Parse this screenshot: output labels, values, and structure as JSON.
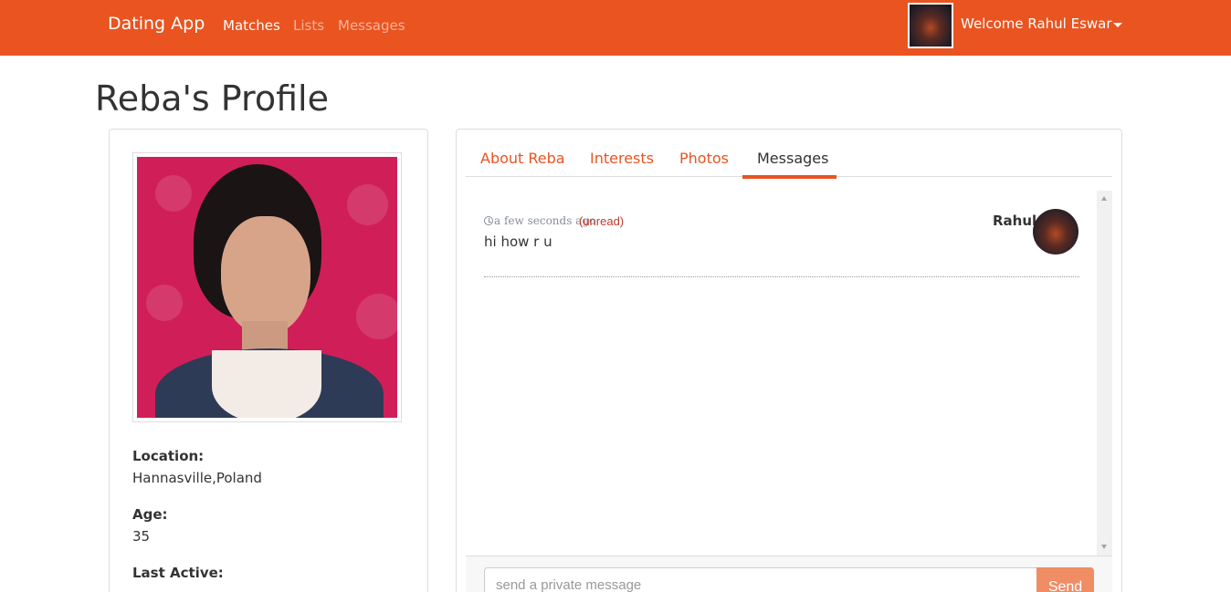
{
  "navbar": {
    "brand": "Dating App",
    "links": [
      "Matches",
      "Lists",
      "Messages"
    ],
    "welcome": "Welcome Rahul Eswar",
    "colors": {
      "background": "#e95420"
    }
  },
  "page": {
    "title": "Reba's Profile"
  },
  "profile": {
    "location_label": "Location:",
    "location": "Hannasville,Poland",
    "age_label": "Age:",
    "age": "35",
    "last_active_label": "Last Active:"
  },
  "tabs": [
    {
      "label": "About Reba",
      "active": false
    },
    {
      "label": "Interests",
      "active": false
    },
    {
      "label": "Photos",
      "active": false
    },
    {
      "label": "Messages",
      "active": true
    }
  ],
  "messages": [
    {
      "sender": "Rahul",
      "time": "a few seconds ago",
      "status": "(unread)",
      "content": "hi how r u"
    }
  ],
  "composer": {
    "placeholder": "send a private message",
    "send_label": "Send"
  },
  "icons": [
    "user-avatar-icon",
    "caret-down-icon",
    "clock-icon",
    "scroll-up-arrow-icon",
    "scroll-down-arrow-icon"
  ]
}
